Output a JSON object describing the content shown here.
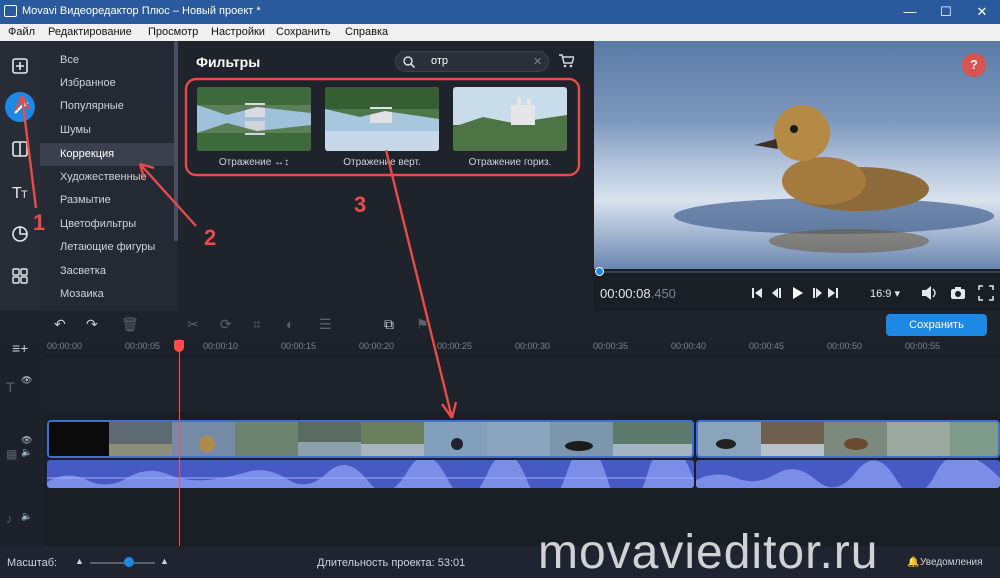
{
  "window": {
    "title": "Movavi Видеоредактор Плюс – Новый проект *",
    "minimize": "—",
    "maximize": "☐",
    "close": "✕"
  },
  "menu": [
    "Файл",
    "Редактирование",
    "Просмотр",
    "Настройки",
    "Сохранить",
    "Справка"
  ],
  "categories": [
    "Все",
    "Избранное",
    "Популярные",
    "Шумы",
    "Коррекция",
    "Художественные",
    "Размытие",
    "Цветофильтры",
    "Летающие фигуры",
    "Засветка",
    "Мозаика"
  ],
  "selected_category": "Коррекция",
  "filters": {
    "title": "Фильтры",
    "search_value": "отр",
    "items": [
      {
        "label": "Отражение ↔↕"
      },
      {
        "label": "Отражение верт."
      },
      {
        "label": "Отражение гориз."
      }
    ]
  },
  "preview": {
    "timecode_main": "00:00:08",
    "timecode_frac": ".450",
    "aspect": "16:9 ▾",
    "help": "?"
  },
  "toolbar": {
    "save_label": "Сохранить"
  },
  "ruler": [
    "00:00:00",
    "00:00:05",
    "00:00:10",
    "00:00:15",
    "00:00:20",
    "00:00:25",
    "00:00:30",
    "00:00:35",
    "00:00:40",
    "00:00:45",
    "00:00:50",
    "00:00:55"
  ],
  "status": {
    "scale_label": "Масштаб:",
    "duration_label": "Длительность проекта: 53:01",
    "notifications": "Уведомления"
  },
  "annotations": [
    "1",
    "2",
    "3"
  ],
  "watermark": "movavieditor.ru",
  "colors": {
    "accent": "#1e88e5",
    "annotation": "#e84b48",
    "audio": "#4759c2"
  }
}
